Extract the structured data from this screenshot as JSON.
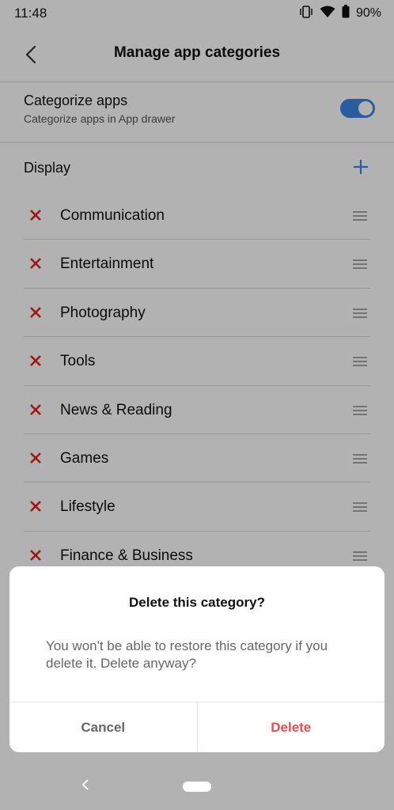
{
  "status_bar": {
    "time": "11:48",
    "battery": "90%",
    "icons": [
      "vibrate-icon",
      "wifi-icon",
      "battery-icon"
    ]
  },
  "header": {
    "title": "Manage app categories",
    "back_icon": "back-arrow-icon"
  },
  "categorize": {
    "title": "Categorize apps",
    "subtitle": "Categorize apps in App drawer",
    "toggle_on": true
  },
  "display": {
    "label": "Display",
    "add_icon": "plus-icon"
  },
  "categories": [
    {
      "label": "Communication"
    },
    {
      "label": "Entertainment"
    },
    {
      "label": "Photography"
    },
    {
      "label": "Tools"
    },
    {
      "label": "News & Reading"
    },
    {
      "label": "Games"
    },
    {
      "label": "Lifestyle"
    },
    {
      "label": "Finance & Business"
    }
  ],
  "dialog": {
    "title": "Delete this category?",
    "message": "You won't be able to restore this category if you delete it. Delete anyway?",
    "cancel_label": "Cancel",
    "delete_label": "Delete"
  },
  "colors": {
    "accent": "#3d86e4",
    "remove": "#e0231b",
    "delete": "#f04a4a"
  }
}
